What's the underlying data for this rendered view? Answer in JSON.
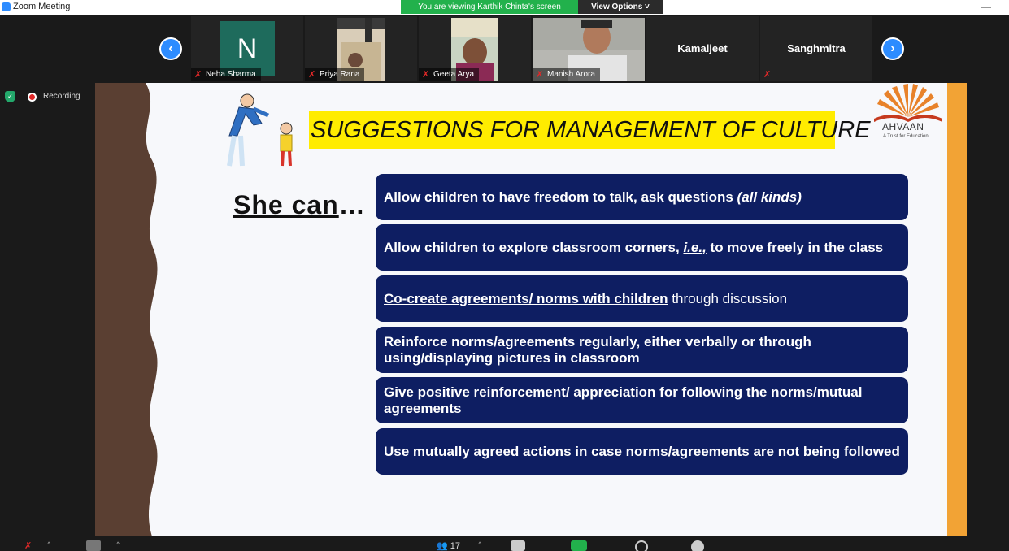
{
  "window": {
    "app_title": "Zoom Meeting",
    "minimize_glyph": "—"
  },
  "share_banner": {
    "text": "You are viewing Karthik Chinta's screen",
    "view_options_label": "View Options ˅",
    "color": "#22b14c"
  },
  "participants": {
    "prev_arrow": "‹",
    "next_arrow": "›",
    "tiles": [
      {
        "name": "Neha Sharma",
        "avatar_letter": "N",
        "muted": true,
        "kind": "avatar"
      },
      {
        "name": "Priya Rana",
        "muted": true,
        "kind": "video"
      },
      {
        "name": "Geeta Arya",
        "muted": true,
        "kind": "video"
      },
      {
        "name": "Manish Arora",
        "muted": true,
        "kind": "video"
      },
      {
        "name": "Kamaljeet",
        "muted": false,
        "kind": "name-only"
      },
      {
        "name": "Sanghmitra",
        "muted": true,
        "kind": "name-only"
      }
    ]
  },
  "recording": {
    "label": "Recording"
  },
  "slide": {
    "title": "SUGGESTIONS FOR MANAGEMENT OF CULTURE",
    "lead": "She can",
    "lead_ellipsis": "…",
    "logo_name": "AHVAAN",
    "logo_tagline": "A Trust for Education",
    "points": [
      {
        "text": "Allow children to have freedom to talk, ask questions ",
        "em": "(all kinds)"
      },
      {
        "text": "Allow children to explore classroom corners, ",
        "em": "i.e.,",
        "rest": " to move freely in the class"
      },
      {
        "u": "Co-create agreements/ norms with children",
        "rest": " through discussion"
      },
      {
        "text": "Reinforce norms/agreements regularly, either verbally or through using/displaying pictures in classroom"
      },
      {
        "text": "Give positive reinforcement/ appreciation for following the norms/mutual agreements"
      },
      {
        "text": "Use mutually agreed actions in case norms/agreements are not being followed"
      }
    ],
    "colors": {
      "box": "#0e1e62",
      "title_highlight": "#ffec00",
      "side_band": "#f2a335",
      "wave": "#5a3f32"
    }
  },
  "toolbar": {
    "participants_count": "17"
  }
}
